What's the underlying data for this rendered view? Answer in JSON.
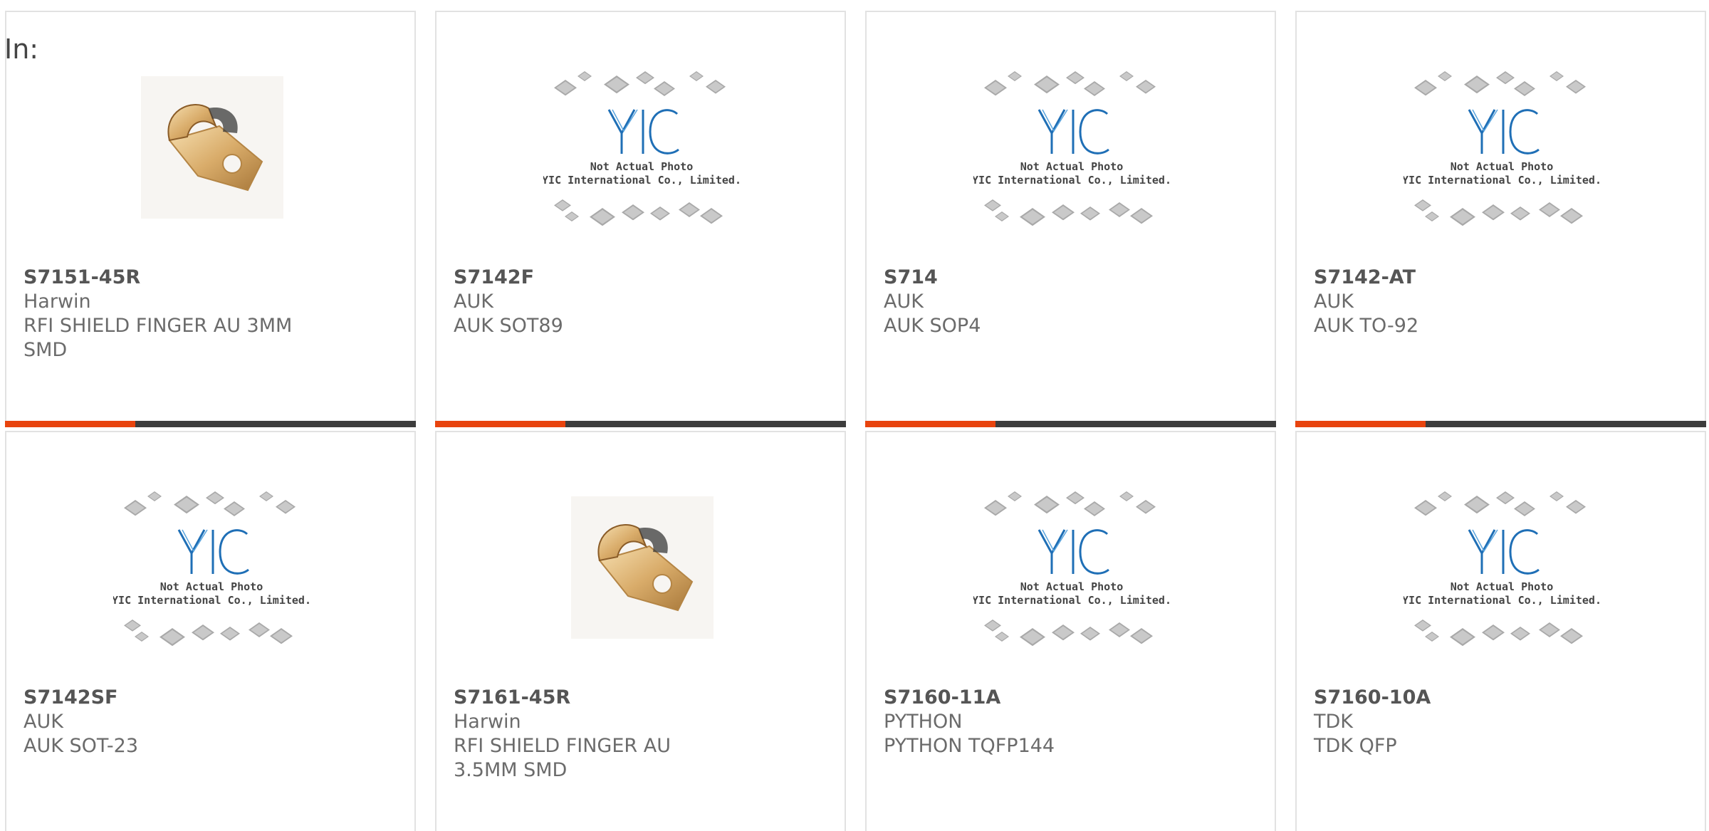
{
  "header": {
    "in_label": "In:"
  },
  "placeholder": {
    "line1": "Not Actual Photo",
    "line2": "YIC International Co., Limited."
  },
  "colors": {
    "accent": "#e8440e",
    "bar": "#3d3d3d",
    "logo_blue": "#1f6fb6"
  },
  "products": [
    {
      "part": "S7151-45R",
      "maker": "Harwin",
      "desc": "RFI SHIELD FINGER AU 3MM SMD",
      "image": "shield-finger"
    },
    {
      "part": "S7142F",
      "maker": "AUK",
      "desc": "AUK SOT89",
      "image": "placeholder"
    },
    {
      "part": "S714",
      "maker": "AUK",
      "desc": "AUK SOP4",
      "image": "placeholder"
    },
    {
      "part": "S7142-AT",
      "maker": "AUK",
      "desc": "AUK TO-92",
      "image": "placeholder"
    },
    {
      "part": "S7142SF",
      "maker": "AUK",
      "desc": "AUK SOT-23",
      "image": "placeholder"
    },
    {
      "part": "S7161-45R",
      "maker": "Harwin",
      "desc": "RFI SHIELD FINGER AU 3.5MM SMD",
      "image": "shield-finger"
    },
    {
      "part": "S7160-11A",
      "maker": "PYTHON",
      "desc": "PYTHON TQFP144",
      "image": "placeholder"
    },
    {
      "part": "S7160-10A",
      "maker": "TDK",
      "desc": "TDK QFP",
      "image": "placeholder"
    }
  ]
}
